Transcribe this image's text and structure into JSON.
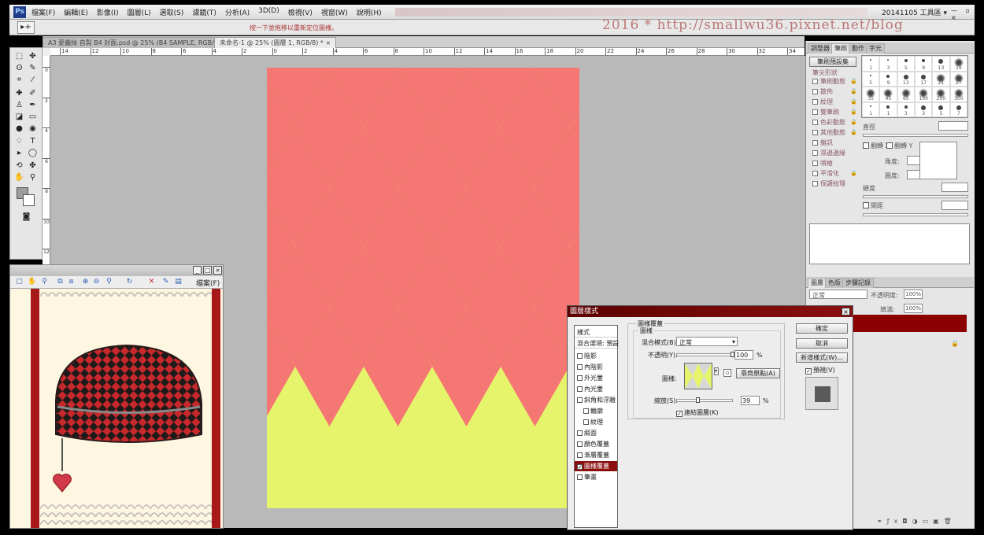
{
  "app": {
    "logo": "Ps",
    "menus": [
      "檔案(F)",
      "編輯(E)",
      "影像(I)",
      "圖層(L)",
      "選取(S)",
      "濾鏡(T)",
      "分析(A)",
      "3D(D)",
      "檢視(V)",
      "視窗(W)",
      "說明(H)"
    ],
    "workspace": "20141105 工具區 ▾",
    "window_buttons": "— ▫ ×"
  },
  "options_bar": {
    "tool_icon": "move-tool",
    "tool_glyph": "▸+",
    "hint": "按一下並拖移以重新定位圖樣。"
  },
  "watermark": "2016 * http://smallwu36.pixnet.net/blog",
  "doc_tabs": [
    {
      "label": "A3 愛麗絲 自製 B4 封面.psd @ 25% (B4 SAMPLE, RGB/8) ×"
    },
    {
      "label": "未命名-1 @ 25% (圖層 1, RGB/8) * ×"
    }
  ],
  "ruler": {
    "h_ticks": [
      "14",
      "12",
      "10",
      "8",
      "6",
      "4",
      "2",
      "0",
      "2",
      "4",
      "6",
      "8",
      "10",
      "12",
      "14",
      "16",
      "18",
      "20",
      "22",
      "24",
      "26",
      "28",
      "30",
      "32",
      "34"
    ],
    "v_ticks": [
      "0",
      "2",
      "4",
      "6",
      "8",
      "10",
      "12",
      "14",
      "16",
      "18",
      "20",
      "22",
      "24",
      "26",
      "28",
      "30"
    ]
  },
  "canvas": {
    "pattern": "harlequin-diamonds",
    "color_a": "#f57773",
    "color_b": "#e6f46c"
  },
  "toolbox": {
    "fg_color": "#9e9e9e",
    "bg_color": "#ffffff"
  },
  "nav_window": {
    "file_label": "檔案(F)",
    "stripe_color": "#a81a1a"
  },
  "brush_panel": {
    "tabs": [
      "調整器",
      "筆刷",
      "動作",
      "字元"
    ],
    "preset_label": "筆刷預設集",
    "tip_shape": "筆尖形狀",
    "options": [
      "筆刷動態",
      "散佈",
      "紋理",
      "雙筆刷",
      "色彩動態",
      "其他動態",
      "雜訊",
      "濕邊邊緣",
      "噴槍",
      "平滑化",
      "保護紋理"
    ],
    "sizes": [
      "1",
      "3",
      "5",
      "9",
      "13",
      "19",
      "5",
      "9",
      "13",
      "17",
      "21",
      "27",
      "35",
      "45",
      "65",
      "100",
      "200",
      "300",
      "1",
      "1",
      "3",
      "3",
      "5",
      "7"
    ],
    "diameter_label": "直徑",
    "flip_x": "翻轉 X",
    "flip_y": "翻轉 Y",
    "angle_label": "角度:",
    "roundness_label": "圓度:",
    "hardness_label": "硬度",
    "spacing_label": "間距"
  },
  "layers_panel": {
    "tabs": [
      "圖層",
      "色版",
      "步驟記錄"
    ],
    "blend_mode": "正常",
    "opacity_label": "不透明度:",
    "opacity_value": "100%",
    "fill_label": "填滿:",
    "fill_value": "100%",
    "active_layer_color": "#8b0000"
  },
  "dialog": {
    "title": "圖層樣式",
    "close": "×",
    "style_header": "樣式",
    "blend_options": "混合選項: 預設",
    "styles": [
      {
        "label": "陰影",
        "checked": false,
        "sub": false
      },
      {
        "label": "內陰影",
        "checked": false,
        "sub": false
      },
      {
        "label": "外光暈",
        "checked": false,
        "sub": false
      },
      {
        "label": "內光暈",
        "checked": false,
        "sub": false
      },
      {
        "label": "斜角和浮雕",
        "checked": false,
        "sub": false
      },
      {
        "label": "輪廓",
        "checked": false,
        "sub": true
      },
      {
        "label": "紋理",
        "checked": false,
        "sub": true
      },
      {
        "label": "緞面",
        "checked": false,
        "sub": false
      },
      {
        "label": "顏色覆蓋",
        "checked": false,
        "sub": false
      },
      {
        "label": "漸層覆蓋",
        "checked": false,
        "sub": false
      },
      {
        "label": "圖樣覆蓋",
        "checked": true,
        "sub": false,
        "selected": true
      },
      {
        "label": "筆畫",
        "checked": false,
        "sub": false
      }
    ],
    "group_title": "圖樣覆蓋",
    "subgroup_title": "圖樣",
    "blend_mode_label": "混合模式(B):",
    "blend_mode_value": "正常",
    "opacity_label": "不透明(Y):",
    "opacity_value": "100",
    "opacity_pct": 100,
    "pattern_label": "圖樣:",
    "snap_button": "靠齊原點(A)",
    "scale_label": "縮放(S):",
    "scale_value": "39",
    "scale_pct": 39,
    "percent": "%",
    "link_label": "連結圖層(K)",
    "link_checked": true,
    "ok": "確定",
    "cancel": "取消",
    "new_style": "新增樣式(W)...",
    "preview_label": "預視(V)",
    "preview_checked": true
  }
}
